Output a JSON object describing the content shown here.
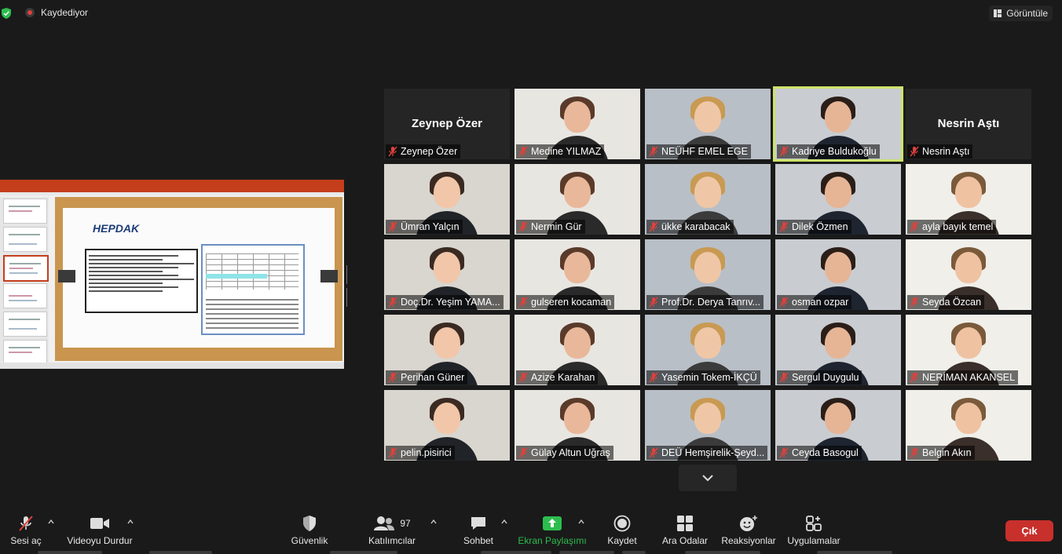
{
  "top": {
    "recording_label": "Kaydediyor",
    "view_label": "Görüntüle"
  },
  "gallery": {
    "tiles": [
      {
        "name": "Zeynep Özer",
        "big_name": "Zeynep Özer",
        "video": false
      },
      {
        "name": "Medine YILMAZ",
        "video": true
      },
      {
        "name": "NEÜHF EMEL EGE",
        "video": true
      },
      {
        "name": "Kadriye Buldukoğlu",
        "video": true,
        "active_speaker": true
      },
      {
        "name": "Nesrin Aştı",
        "big_name": "Nesrin Aştı",
        "video": false
      },
      {
        "name": "Ümran Yalçın",
        "video": true
      },
      {
        "name": "Nermin Gür",
        "video": true
      },
      {
        "name": "ükke karabacak",
        "video": true
      },
      {
        "name": "Dilek Özmen",
        "video": true
      },
      {
        "name": "ayla bayık temel",
        "video": true
      },
      {
        "name": "Doç.Dr. Yeşim YAMA...",
        "video": true
      },
      {
        "name": "gulseren kocaman",
        "video": true
      },
      {
        "name": "Prof.Dr. Derya Tanrıv...",
        "video": true
      },
      {
        "name": "osman ozpar",
        "video": true
      },
      {
        "name": "Seyda Özcan",
        "video": true
      },
      {
        "name": "Perihan Güner",
        "video": true
      },
      {
        "name": "Azize Karahan",
        "video": true
      },
      {
        "name": "Yasemin Tokem-İKÇÜ",
        "video": true
      },
      {
        "name": "Sergul Duygulu",
        "video": true
      },
      {
        "name": "NERİMAN AKANSEL",
        "video": true
      },
      {
        "name": "pelin.pisirici",
        "video": true
      },
      {
        "name": "Gülay Altun Uğraş",
        "video": true
      },
      {
        "name": "DEÜ Hemşirelik-Şeyd...",
        "video": true
      },
      {
        "name": "Ceyda Basogul",
        "video": true
      },
      {
        "name": "Belgin Akın",
        "video": true
      }
    ]
  },
  "toolbar": {
    "mute_label": "Sesi aç",
    "video_label": "Videoyu Durdur",
    "security_label": "Güvenlik",
    "participants_label": "Katılımcılar",
    "participants_count": "97",
    "chat_label": "Sohbet",
    "share_label": "Ekran Paylaşımı",
    "record_label": "Kaydet",
    "breakout_label": "Ara Odalar",
    "reactions_label": "Reaksiyonlar",
    "apps_label": "Uygulamalar",
    "leave_label": "Çık"
  },
  "colors": {
    "background": "#1a1a1a",
    "share_green": "#2dbd4e",
    "leave_red": "#c8302c",
    "active_speaker": "#cde36a",
    "muted_red": "#e0413c"
  }
}
